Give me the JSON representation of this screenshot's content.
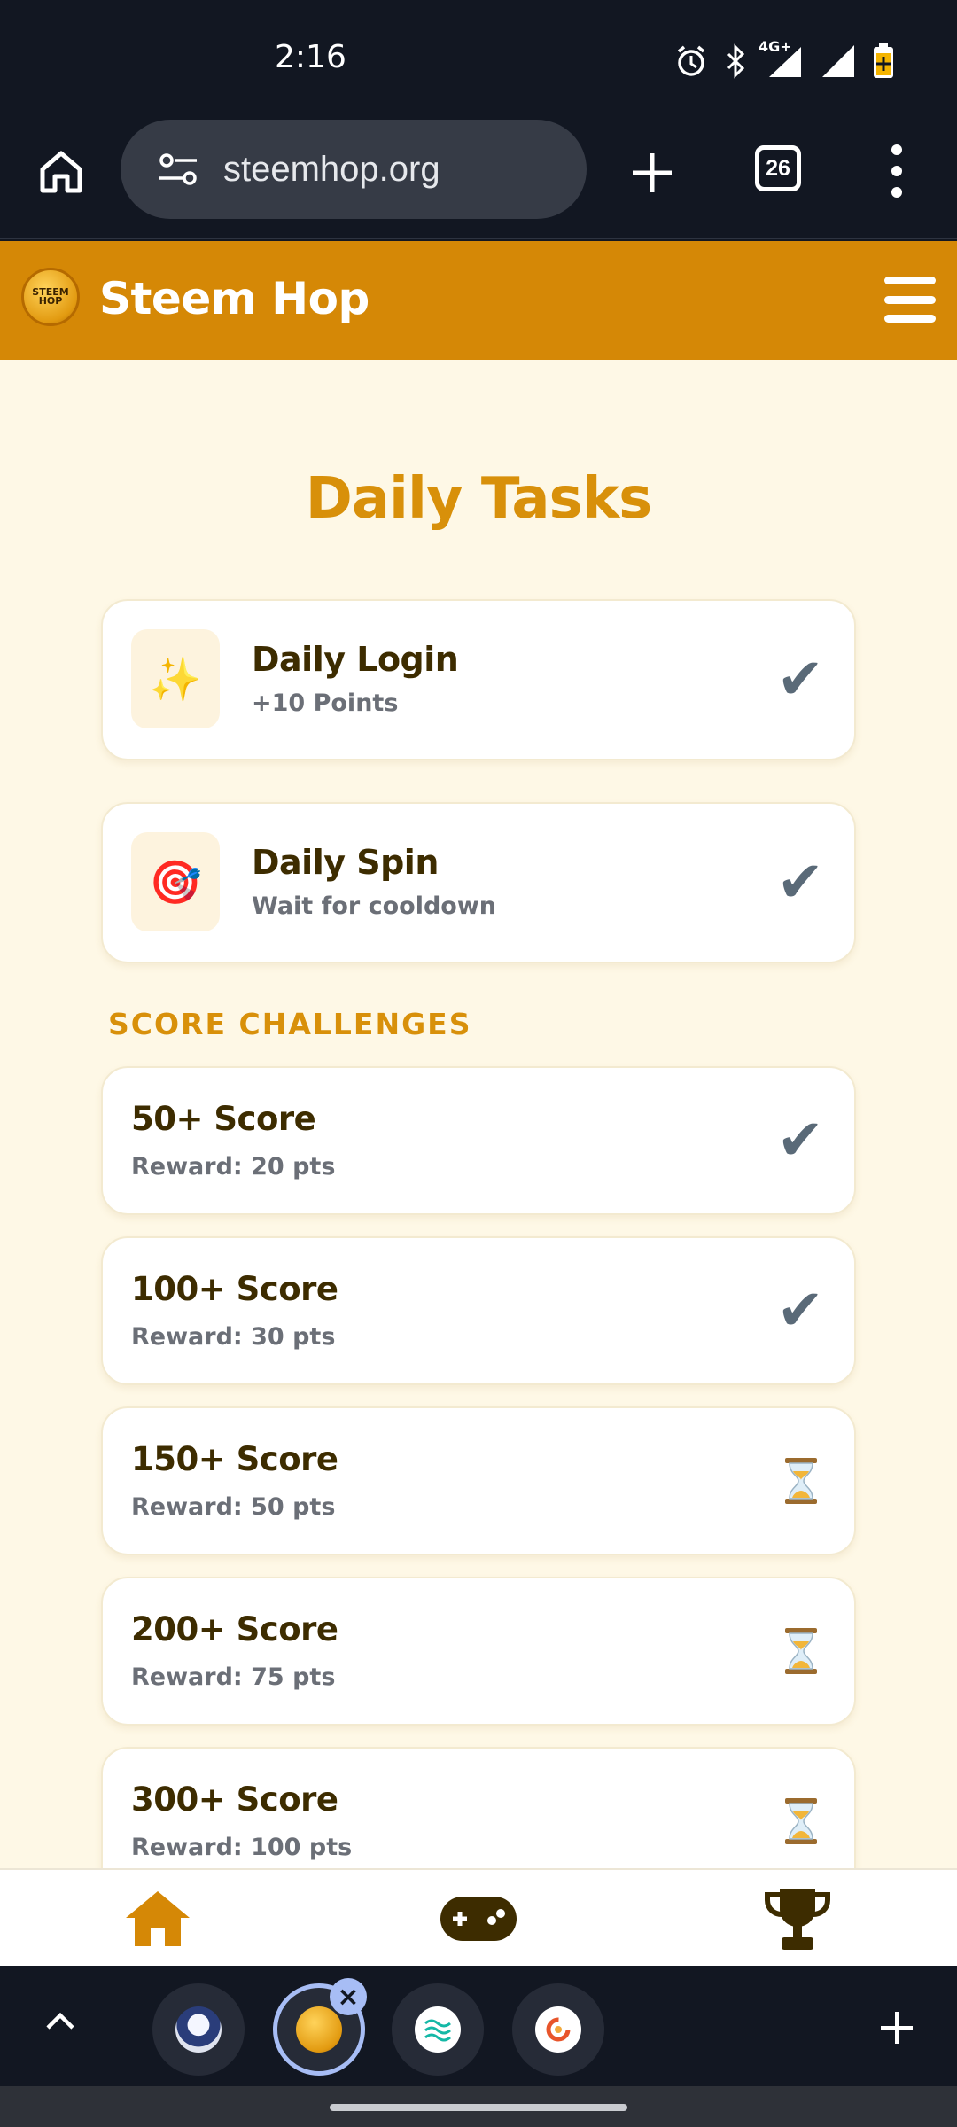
{
  "status_bar": {
    "time": "2:16",
    "network": "4G+"
  },
  "browser": {
    "url": "steemhop.org",
    "tab_count": "26"
  },
  "header": {
    "brand": "Steem Hop",
    "logo_text_line1": "STEEM",
    "logo_text_line2": "HOP"
  },
  "page": {
    "title": "Daily Tasks"
  },
  "tasks": [
    {
      "name": "Daily Login",
      "sub": "+10 Points",
      "icon": "✨",
      "status": "✔"
    },
    {
      "name": "Daily Spin",
      "sub": "Wait for cooldown",
      "icon": "🎯",
      "status": "✔"
    }
  ],
  "challenges": {
    "label": "SCORE CHALLENGES",
    "items": [
      {
        "name": "50+ Score",
        "reward": "Reward: 20 pts",
        "status": "✔"
      },
      {
        "name": "100+ Score",
        "reward": "Reward: 30 pts",
        "status": "✔"
      },
      {
        "name": "150+ Score",
        "reward": "Reward: 50 pts",
        "status": "hourglass"
      },
      {
        "name": "200+ Score",
        "reward": "Reward: 75 pts",
        "status": "hourglass"
      },
      {
        "name": "300+ Score",
        "reward": "Reward: 100 pts",
        "status": "hourglass"
      }
    ]
  },
  "bottom_nav": {
    "items": [
      "home-icon",
      "gamepad-icon",
      "trophy-icon"
    ],
    "active": "home-icon"
  },
  "colors": {
    "accent": "#d58806",
    "title": "#d8900a",
    "background": "#fef8e6",
    "text_dark": "#3d2c00"
  }
}
